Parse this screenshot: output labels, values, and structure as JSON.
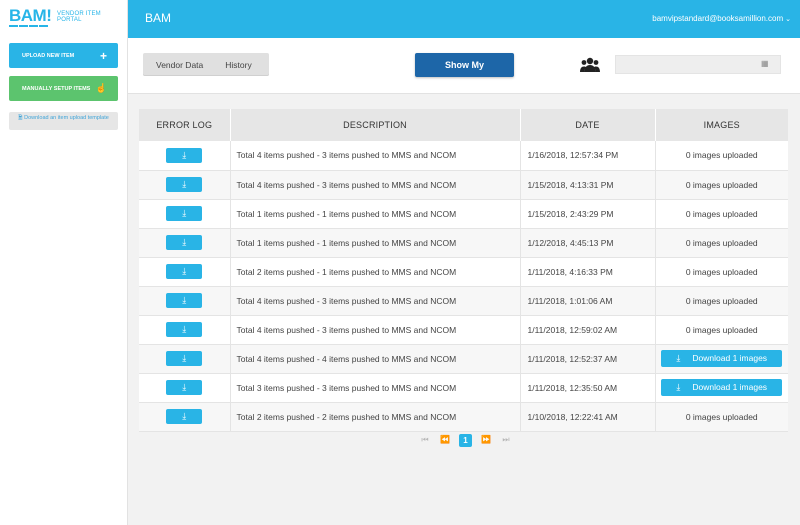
{
  "brand": {
    "logo_text": "BAM!",
    "portal_title": "VENDOR ITEM PORTAL",
    "accent_color": "#29b4e6"
  },
  "sidebar": {
    "upload_label": "UPLOAD NEW ITEM",
    "upload_icon": "plus-icon",
    "manual_label": "MANUALLY SETUP ITEMS",
    "manual_icon": "hand-pointer-icon",
    "template_link": "Download an item upload template"
  },
  "header": {
    "title": "BAM",
    "user_email": "bamvipstandard@booksamillion.com"
  },
  "controls": {
    "tabs": [
      "Vendor Data",
      "History"
    ],
    "show_my": "Show My",
    "date_placeholder": ""
  },
  "table": {
    "columns": [
      "ERROR LOG",
      "DESCRIPTION",
      "DATE",
      "IMAGES"
    ],
    "rows": [
      {
        "description": "Total 4 items pushed - 3 items pushed to MMS and NCOM",
        "date": "1/16/2018, 12:57:34 PM",
        "images": "0 images uploaded",
        "has_download": false
      },
      {
        "description": "Total 4 items pushed - 3 items pushed to MMS and NCOM",
        "date": "1/15/2018, 4:13:31 PM",
        "images": "0 images uploaded",
        "has_download": false
      },
      {
        "description": "Total 1 items pushed - 1 items pushed to MMS and NCOM",
        "date": "1/15/2018, 2:43:29 PM",
        "images": "0 images uploaded",
        "has_download": false
      },
      {
        "description": "Total 1 items pushed - 1 items pushed to MMS and NCOM",
        "date": "1/12/2018, 4:45:13 PM",
        "images": "0 images uploaded",
        "has_download": false
      },
      {
        "description": "Total 2 items pushed - 1 items pushed to MMS and NCOM",
        "date": "1/11/2018, 4:16:33 PM",
        "images": "0 images uploaded",
        "has_download": false
      },
      {
        "description": "Total 4 items pushed - 3 items pushed to MMS and NCOM",
        "date": "1/11/2018, 1:01:06 AM",
        "images": "0 images uploaded",
        "has_download": false
      },
      {
        "description": "Total 4 items pushed - 3 items pushed to MMS and NCOM",
        "date": "1/11/2018, 12:59:02 AM",
        "images": "0 images uploaded",
        "has_download": false
      },
      {
        "description": "Total 4 items pushed - 4 items pushed to MMS and NCOM",
        "date": "1/11/2018, 12:52:37 AM",
        "images": "Download 1 images",
        "has_download": true
      },
      {
        "description": "Total 3 items pushed - 3 items pushed to MMS and NCOM",
        "date": "1/11/2018, 12:35:50 AM",
        "images": "Download 1 images",
        "has_download": true
      },
      {
        "description": "Total 2 items pushed - 2 items pushed to MMS and NCOM",
        "date": "1/10/2018, 12:22:41 AM",
        "images": "0 images uploaded",
        "has_download": false
      }
    ]
  },
  "pagination": {
    "first": "⏮",
    "prev": "⏪",
    "current": "1",
    "next": "⏩",
    "last": "⏭"
  }
}
